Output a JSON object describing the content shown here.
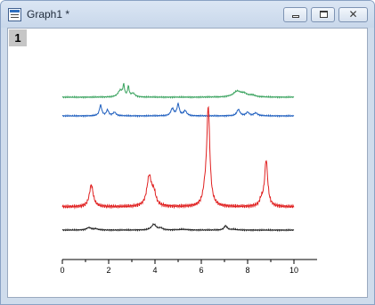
{
  "window": {
    "title": "Graph1 *",
    "icon": "graph-window-icon",
    "controls": {
      "minimize": "minimize-icon",
      "maximize": "maximize-icon",
      "close": "close-icon"
    }
  },
  "layer": {
    "label": "1"
  },
  "chart_data": {
    "type": "line",
    "title": "",
    "xlabel": "",
    "ylabel": "",
    "xlim": [
      0,
      10
    ],
    "x_ticks": [
      "0",
      "2",
      "4",
      "6",
      "8",
      "10"
    ],
    "y_axis_visible": false,
    "grid": false,
    "legend": "none",
    "series_colors": {
      "green": "#3aa35f",
      "blue": "#1f5fbf",
      "red": "#e02020",
      "black": "#222222"
    },
    "series": [
      {
        "color_key": "green",
        "baseline": 0,
        "peaks": [
          {
            "x": 2.5,
            "h": 0.18,
            "w": 0.12
          },
          {
            "x": 2.65,
            "h": 0.3,
            "w": 0.04
          },
          {
            "x": 2.85,
            "h": 0.28,
            "w": 0.04
          },
          {
            "x": 3.05,
            "h": 0.1,
            "w": 0.1
          },
          {
            "x": 7.55,
            "h": 0.16,
            "w": 0.2
          },
          {
            "x": 7.85,
            "h": 0.08,
            "w": 0.15
          },
          {
            "x": 8.2,
            "h": 0.05,
            "w": 0.15
          }
        ]
      },
      {
        "color_key": "blue",
        "baseline": 0,
        "peaks": [
          {
            "x": 1.65,
            "h": 0.3,
            "w": 0.06
          },
          {
            "x": 1.95,
            "h": 0.16,
            "w": 0.06
          },
          {
            "x": 2.25,
            "h": 0.1,
            "w": 0.08
          },
          {
            "x": 4.75,
            "h": 0.2,
            "w": 0.08
          },
          {
            "x": 5.0,
            "h": 0.32,
            "w": 0.06
          },
          {
            "x": 5.3,
            "h": 0.14,
            "w": 0.08
          },
          {
            "x": 7.6,
            "h": 0.18,
            "w": 0.08
          },
          {
            "x": 8.0,
            "h": 0.1,
            "w": 0.08
          },
          {
            "x": 8.35,
            "h": 0.08,
            "w": 0.1
          }
        ]
      },
      {
        "color_key": "red",
        "baseline": 0,
        "peaks": [
          {
            "x": 1.25,
            "h": 0.22,
            "w": 0.1
          },
          {
            "x": 3.75,
            "h": 0.3,
            "w": 0.12
          },
          {
            "x": 3.95,
            "h": 0.12,
            "w": 0.1
          },
          {
            "x": 6.3,
            "h": 0.98,
            "w": 0.08
          },
          {
            "x": 6.15,
            "h": 0.1,
            "w": 0.1
          },
          {
            "x": 8.8,
            "h": 0.46,
            "w": 0.08
          },
          {
            "x": 8.6,
            "h": 0.06,
            "w": 0.1
          }
        ]
      },
      {
        "color_key": "black",
        "baseline": 0,
        "peaks": [
          {
            "x": 1.15,
            "h": 0.07,
            "w": 0.12
          },
          {
            "x": 1.45,
            "h": 0.03,
            "w": 0.1
          },
          {
            "x": 3.95,
            "h": 0.16,
            "w": 0.12
          },
          {
            "x": 4.25,
            "h": 0.05,
            "w": 0.1
          },
          {
            "x": 5.2,
            "h": 0.02,
            "w": 0.2
          },
          {
            "x": 7.05,
            "h": 0.12,
            "w": 0.08
          },
          {
            "x": 7.4,
            "h": 0.02,
            "w": 0.12
          }
        ]
      }
    ]
  }
}
